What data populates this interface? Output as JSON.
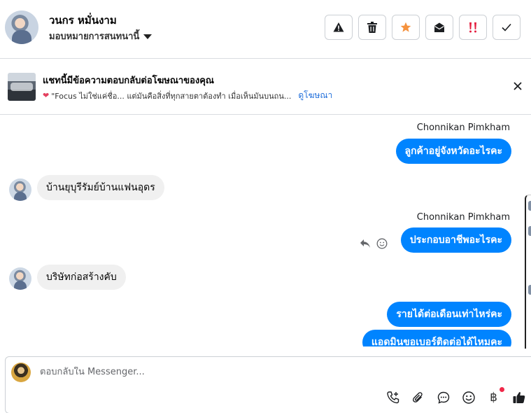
{
  "header": {
    "contact_name": "วนกร หมั่นงาม",
    "assign_label": "มอบหมายการสนทนานี้",
    "actions": [
      {
        "icon": "warning-icon",
        "name": "mark-spam-button"
      },
      {
        "icon": "trash-icon",
        "name": "delete-button"
      },
      {
        "icon": "star-icon",
        "name": "star-button",
        "color": "#f5923e"
      },
      {
        "icon": "envelope-open-icon",
        "name": "mark-unread-button"
      },
      {
        "icon": "priority-icon",
        "name": "priority-button",
        "color": "#e41e3f"
      },
      {
        "icon": "check-icon",
        "name": "mark-done-button"
      }
    ]
  },
  "banner": {
    "title": "แชทนี้มีข้อความตอบกลับต่อโฆษณาของคุณ",
    "ad_text": "\"Focus ไม่ใช่แค่ชื่อ... แต่มันคือสิ่งที่ทุกสายตาต้องทำ เมื่อเห็นมันบนถน...",
    "link": "ดูโฆษณา"
  },
  "messages": [
    {
      "direction": "out",
      "sender": "Chonnikan Pimkham",
      "text": "ลูกค้าอยู่จังหวัดอะไรคะ"
    },
    {
      "direction": "in",
      "text": "บ้านยุบุรีรัมย์บ้านแฟนอุดร"
    },
    {
      "direction": "out",
      "sender": "Chonnikan Pimkham",
      "text": "ประกอบอาชีพอะไรคะ"
    },
    {
      "direction": "in",
      "text": "บริษัทก่อสร้างคับ"
    },
    {
      "direction": "out",
      "text": "รายได้ต่อเดือนเท่าไหร่คะ"
    },
    {
      "direction": "out",
      "text": "แอดมินขอเบอร์ติดต่อได้ไหมคะ"
    }
  ],
  "composer": {
    "placeholder": "ตอบกลับใน Messenger...",
    "currency_symbol": "฿"
  },
  "colors": {
    "outgoing_bubble": "#0084ff",
    "incoming_bubble": "#f0f0f0",
    "link": "#216fdb"
  }
}
